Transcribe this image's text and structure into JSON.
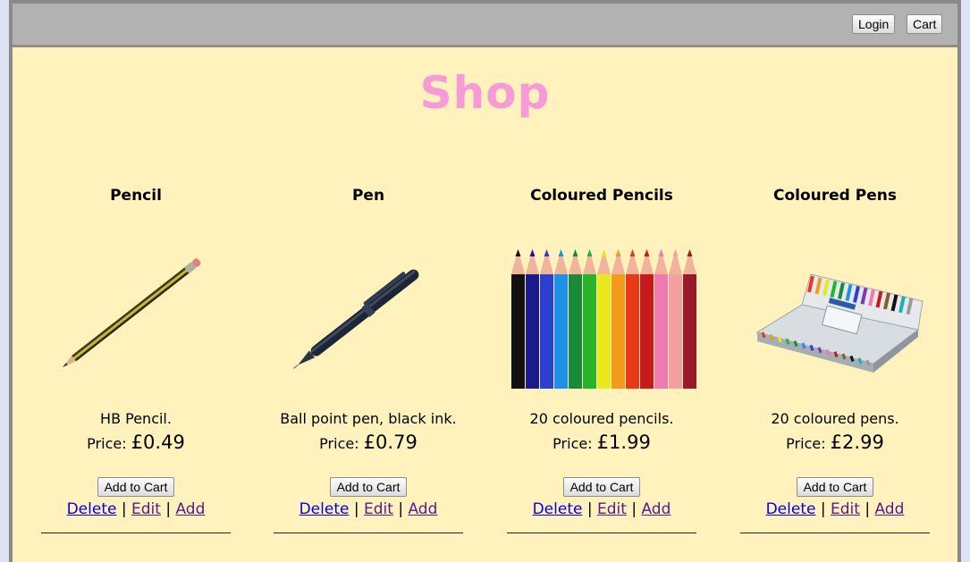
{
  "header": {
    "login_label": "Login",
    "cart_label": "Cart"
  },
  "page": {
    "title": "Shop",
    "title_color": "#f79ad8",
    "background": "#fff2bd"
  },
  "products": [
    {
      "name": "Pencil",
      "image": "pencil-image",
      "description": "HB Pencil.",
      "price_label": "Price:",
      "price": "£0.49",
      "add_label": "Add to Cart",
      "delete_label": "Delete",
      "edit_label": "Edit",
      "add_link_label": "Add"
    },
    {
      "name": "Pen",
      "image": "pen-image",
      "description": "Ball point pen, black ink.",
      "price_label": "Price:",
      "price": "£0.79",
      "add_label": "Add to Cart",
      "delete_label": "Delete",
      "edit_label": "Edit",
      "add_link_label": "Add"
    },
    {
      "name": "Coloured Pencils",
      "image": "coloured-pencils-image",
      "description": "20 coloured pencils.",
      "price_label": "Price:",
      "price": "£1.99",
      "add_label": "Add to Cart",
      "delete_label": "Delete",
      "edit_label": "Edit",
      "add_link_label": "Add"
    },
    {
      "name": "Coloured Pens",
      "image": "coloured-pens-image",
      "description": "20 coloured pens.",
      "price_label": "Price:",
      "price": "£2.99",
      "add_label": "Add to Cart",
      "delete_label": "Delete",
      "edit_label": "Edit",
      "add_link_label": "Add"
    }
  ]
}
